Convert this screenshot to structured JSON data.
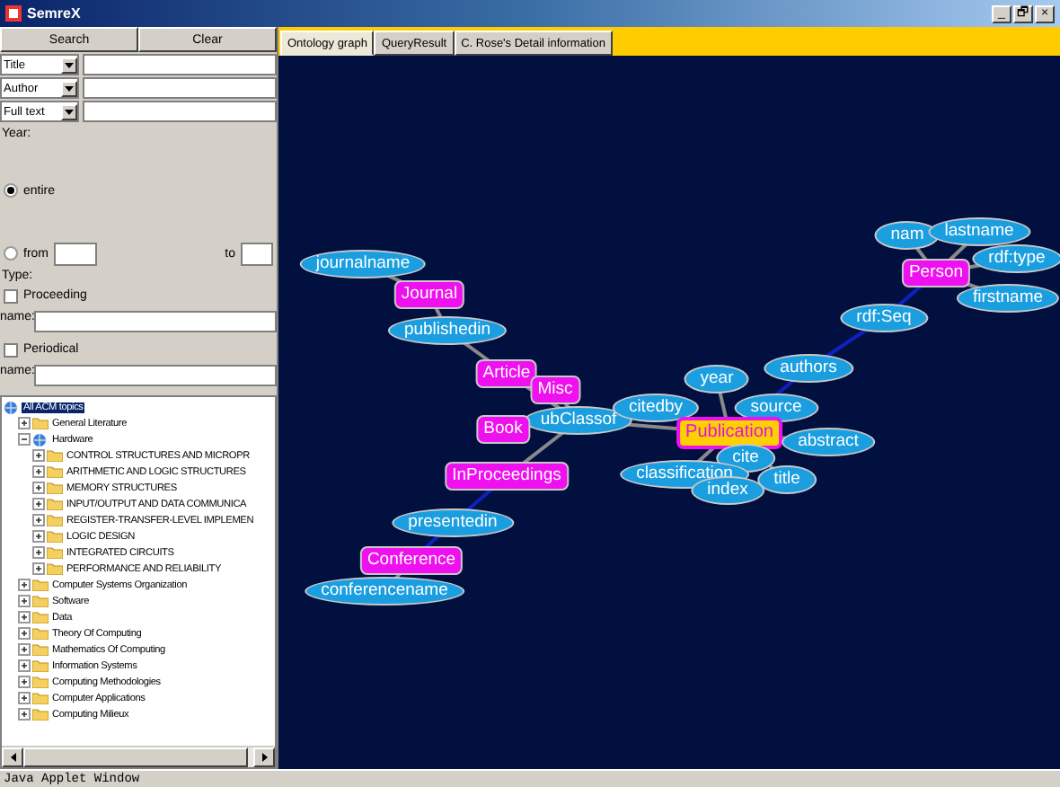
{
  "window": {
    "title": "SemreX",
    "controls": [
      "_",
      "🗗",
      "×"
    ]
  },
  "search_panel": {
    "buttons": [
      "Search",
      "Clear"
    ],
    "fields": [
      {
        "select": "Title"
      },
      {
        "select": "Author"
      },
      {
        "select": "Full text"
      }
    ],
    "year_label": "Year:",
    "year_options": [
      {
        "label": "entire",
        "selected": true
      },
      {
        "label": "from",
        "selected": false
      }
    ],
    "to_label": "to",
    "type_label": "Type:",
    "types": [
      {
        "label": "Proceeding",
        "checked": false,
        "name_label": "name:"
      },
      {
        "label": "Periodical",
        "checked": false,
        "name_label": "name:"
      }
    ]
  },
  "tree": [
    {
      "label": "All ACM topics",
      "kind": "root",
      "expanded": true,
      "selected": true,
      "children": [
        {
          "label": "General Literature",
          "kind": "folder",
          "expanded": false,
          "selected": false
        },
        {
          "label": "Hardware",
          "kind": "root",
          "expanded": true,
          "selected": false,
          "children": [
            {
              "label": "CONTROL STRUCTURES AND MICROPR",
              "kind": "folder",
              "expanded": false,
              "selected": false
            },
            {
              "label": "ARITHMETIC AND LOGIC STRUCTURES",
              "kind": "folder",
              "expanded": false,
              "selected": false
            },
            {
              "label": "MEMORY STRUCTURES",
              "kind": "folder",
              "expanded": false,
              "selected": false
            },
            {
              "label": "INPUT/OUTPUT AND DATA COMMUNICA",
              "kind": "folder",
              "expanded": false,
              "selected": false
            },
            {
              "label": "REGISTER-TRANSFER-LEVEL IMPLEMEN",
              "kind": "folder",
              "expanded": false,
              "selected": false
            },
            {
              "label": "LOGIC DESIGN",
              "kind": "folder",
              "expanded": false,
              "selected": false
            },
            {
              "label": "INTEGRATED CIRCUITS",
              "kind": "folder",
              "expanded": false,
              "selected": false
            },
            {
              "label": "PERFORMANCE AND RELIABILITY",
              "kind": "folder",
              "expanded": false,
              "selected": false
            }
          ]
        },
        {
          "label": "Computer Systems Organization",
          "kind": "folder",
          "expanded": false,
          "selected": false
        },
        {
          "label": "Software",
          "kind": "folder",
          "expanded": false,
          "selected": false
        },
        {
          "label": "Data",
          "kind": "folder",
          "expanded": false,
          "selected": false
        },
        {
          "label": "Theory Of Computing",
          "kind": "folder",
          "expanded": false,
          "selected": false
        },
        {
          "label": "Mathematics Of Computing",
          "kind": "folder",
          "expanded": false,
          "selected": false
        },
        {
          "label": "Information Systems",
          "kind": "folder",
          "expanded": false,
          "selected": false
        },
        {
          "label": "Computing Methodologies",
          "kind": "folder",
          "expanded": false,
          "selected": false
        },
        {
          "label": "Computer Applications",
          "kind": "folder",
          "expanded": false,
          "selected": false
        },
        {
          "label": "Computing Milieux",
          "kind": "folder",
          "expanded": false,
          "selected": false
        }
      ]
    }
  ],
  "tabs": [
    {
      "label": "Ontology graph",
      "selected": true
    },
    {
      "label": "QueryResult",
      "selected": false
    },
    {
      "label": "C. Rose's Detail information",
      "selected": false
    }
  ],
  "graph": {
    "nodes": [
      {
        "label": "journalname",
        "kind": "property"
      },
      {
        "label": "Journal",
        "kind": "class"
      },
      {
        "label": "publishedin",
        "kind": "property"
      },
      {
        "label": "Article",
        "kind": "class"
      },
      {
        "label": "Misc",
        "kind": "class"
      },
      {
        "label": "ubClassof",
        "kind": "property"
      },
      {
        "label": "Book",
        "kind": "class"
      },
      {
        "label": "InProceedings",
        "kind": "class"
      },
      {
        "label": "presentedin",
        "kind": "property"
      },
      {
        "label": "Conference",
        "kind": "class"
      },
      {
        "label": "conferencename",
        "kind": "property"
      },
      {
        "label": "year",
        "kind": "property"
      },
      {
        "label": "citedby",
        "kind": "property"
      },
      {
        "label": "source",
        "kind": "property"
      },
      {
        "label": "authors",
        "kind": "property"
      },
      {
        "label": "rdf:Seq",
        "kind": "property"
      },
      {
        "label": "Publication",
        "kind": "focus"
      },
      {
        "label": "cite",
        "kind": "property"
      },
      {
        "label": "abstract",
        "kind": "property"
      },
      {
        "label": "classification",
        "kind": "property"
      },
      {
        "label": "index",
        "kind": "property"
      },
      {
        "label": "title",
        "kind": "property"
      },
      {
        "label": "nam",
        "kind": "property"
      },
      {
        "label": "lastname",
        "kind": "property"
      },
      {
        "label": "Person",
        "kind": "class"
      },
      {
        "label": "rdf:type",
        "kind": "property"
      },
      {
        "label": "firstname",
        "kind": "property"
      }
    ]
  },
  "status_bar": "Java Applet Window"
}
